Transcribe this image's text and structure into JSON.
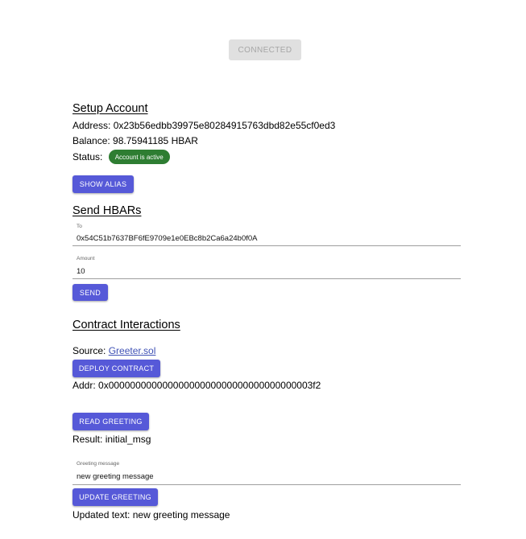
{
  "header": {
    "connected_label": "CONNECTED"
  },
  "setup_account": {
    "title": "Setup Account",
    "address_label": "Address:",
    "address_value": "0x23b56edbb39975e80284915763dbd82e55cf0ed3",
    "balance_label": "Balance:",
    "balance_value": "98.75941185 HBAR",
    "status_label": "Status:",
    "status_badge": "Account is active",
    "show_alias_label": "SHOW ALIAS"
  },
  "send_hbars": {
    "title": "Send HBARs",
    "to_label": "To",
    "to_value": "0x54C51b7637BF6fE9709e1e0EBc8b2Ca6a24b0f0A",
    "amount_label": "Amount",
    "amount_value": "10",
    "send_label": "SEND"
  },
  "contract": {
    "title": "Contract Interactions",
    "source_label": "Source:",
    "source_link": "Greeter.sol",
    "deploy_label": "DEPLOY CONTRACT",
    "addr_label": "Addr:",
    "addr_value": "0x00000000000000000000000000000000000003f2",
    "read_label": "READ GREETING",
    "result_label": "Result:",
    "result_value": "initial_msg",
    "greeting_label": "Greeting message",
    "greeting_value": "new greeting message",
    "update_label": "UPDATE GREETING",
    "updated_label": "Updated text:",
    "updated_value": "new greeting message"
  },
  "colors": {
    "primary_button": "#5659d8",
    "success_badge": "#2e7d32",
    "disabled_button_bg": "#e0e0e0",
    "link": "#3f51b5"
  }
}
